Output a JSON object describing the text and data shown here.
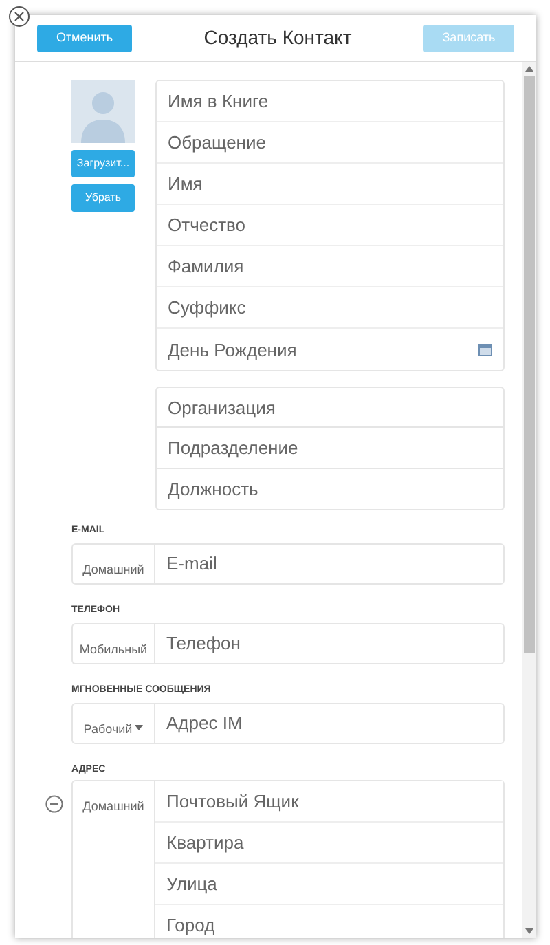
{
  "header": {
    "cancel": "Отменить",
    "title": "Создать Контакт",
    "save": {
      "label": "Записать",
      "disabled": true
    }
  },
  "photo": {
    "upload": "Загрузит...",
    "remove": "Убрать"
  },
  "name_fields": [
    {
      "placeholder": "Имя в Книге",
      "kind": "text"
    },
    {
      "placeholder": "Обращение",
      "kind": "text"
    },
    {
      "placeholder": "Имя",
      "kind": "text"
    },
    {
      "placeholder": "Отчество",
      "kind": "text"
    },
    {
      "placeholder": "Фамилия",
      "kind": "text"
    },
    {
      "placeholder": "Суффикс",
      "kind": "text"
    },
    {
      "placeholder": "День Рождения",
      "kind": "date"
    }
  ],
  "org_fields": [
    {
      "placeholder": "Организация"
    },
    {
      "placeholder": "Подразделение"
    },
    {
      "placeholder": "Должность"
    }
  ],
  "contact_sections": [
    {
      "label": "E-MAIL",
      "type": {
        "label": "Домашний",
        "dropdown": false
      },
      "placeholder": "E-mail"
    },
    {
      "label": "ТЕЛЕФОН",
      "type": {
        "label": "Мобильный",
        "dropdown": false
      },
      "placeholder": "Телефон"
    },
    {
      "label": "МГНОВЕННЫЕ СООБЩЕНИЯ",
      "type": {
        "label": "Рабочий",
        "dropdown": true
      },
      "placeholder": "Адрес IM"
    }
  ],
  "address": {
    "label": "АДРЕС",
    "removable": true,
    "type": {
      "label": "Домашний",
      "dropdown": false
    },
    "fields": [
      {
        "placeholder": "Почтовый Ящик"
      },
      {
        "placeholder": "Квартира"
      },
      {
        "placeholder": "Улица"
      },
      {
        "placeholder": "Город"
      }
    ]
  }
}
